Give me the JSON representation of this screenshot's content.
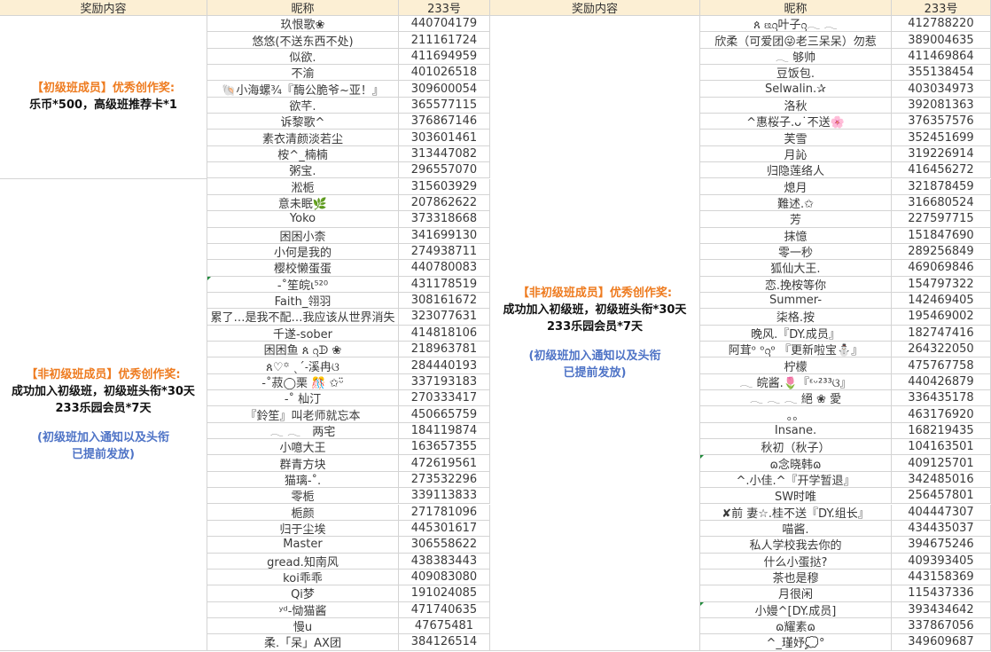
{
  "headers": {
    "reward": "奖励内容",
    "nickname": "昵称",
    "id": "233号"
  },
  "left": {
    "reward_blocks": [
      {
        "title": "【初级班成员】优秀创作奖:",
        "lines": [
          "乐币*500，高级班推荐卡*1"
        ],
        "note_lines": []
      },
      {
        "title": "【非初级班成员】优秀创作奖:",
        "lines": [
          "成功加入初级班，初级班头衔*30天",
          "233乐园会员*7天"
        ],
        "note_lines": [
          "(初级班加入通知以及头衔",
          "已提前发放)"
        ]
      }
    ],
    "rows": [
      {
        "name": "玖恨歌❀",
        "id": "440704179"
      },
      {
        "name": "悠悠(不送东西不处)",
        "id": "211161724"
      },
      {
        "name": "似欲.",
        "id": "411694959"
      },
      {
        "name": "不渝",
        "id": "401026518"
      },
      {
        "name": "🐚小海螺¾『酶公脆爷~亚！』",
        "id": "309600054"
      },
      {
        "name": "欲芊.",
        "id": "365577115"
      },
      {
        "name": "诉黎歌^",
        "id": "376867146"
      },
      {
        "name": "素衣清颜淡若尘",
        "id": "303601461"
      },
      {
        "name": "桉^_楠楠",
        "id": "313447082"
      },
      {
        "name": "粥宝.",
        "id": "296557070"
      },
      {
        "name": "淞栀",
        "id": "315603929"
      },
      {
        "name": "意未眠🌿",
        "id": "207862622"
      },
      {
        "name": "Yoko",
        "id": "373318668"
      },
      {
        "name": "困困小柰",
        "id": "341699130"
      },
      {
        "name": "小何是我的",
        "id": "274938711"
      },
      {
        "name": "樱校懒蛋蛋",
        "id": "440780083"
      },
      {
        "name": "-˚笙皖ι⁵²⁰",
        "id": "431178519"
      },
      {
        "name": "Faith_翎羽",
        "id": "308161672"
      },
      {
        "name": "累了…是我不配…我应该从世界消失",
        "id": "323077631"
      },
      {
        "name": "千遂-sober",
        "id": "414818106"
      },
      {
        "name": "困困鱼 ጰ ᦋᗬ ❀",
        "id": "218963781"
      },
      {
        "name": "ጰ♡꙳ ˎˊ˗溪冉ଓ",
        "id": "284440193"
      },
      {
        "name": "-˚菽◯栗 🎊 ✩ᵕ̈",
        "id": "337193183"
      },
      {
        "name": "-˚ 杣汀",
        "id": "270333417"
      },
      {
        "name": "『鈴笙』叫老师就忘本",
        "id": "450665759"
      },
      {
        "name": "𓂃 𓂃　两宅",
        "id": "184119874"
      },
      {
        "name": "小噫大王",
        "id": "163657355"
      },
      {
        "name": "群青方块",
        "id": "472619561"
      },
      {
        "name": "猫璃-˚.",
        "id": "273532296"
      },
      {
        "name": "零栀",
        "id": "339113833"
      },
      {
        "name": "栀颜",
        "id": "271781096"
      },
      {
        "name": "归于尘埃",
        "id": "445301617"
      },
      {
        "name": "Master",
        "id": "306558622"
      },
      {
        "name": "gread.知南风",
        "id": "438383443"
      },
      {
        "name": "koi乖乖",
        "id": "409083080"
      },
      {
        "name": "Qi梦",
        "id": "191024085"
      },
      {
        "name": "ʸᵈ-恸猫酱",
        "id": "471740635"
      },
      {
        "name": "慢u",
        "id": "47675481"
      },
      {
        "name": "柔.「呆」AX团",
        "id": "384126514"
      }
    ]
  },
  "right": {
    "reward_blocks": [
      {
        "title": "【非初级班成员】优秀创作奖:",
        "lines": [
          "成功加入初级班，初级班头衔*30天",
          "233乐园会员*7天"
        ],
        "note_lines": [
          "(初级班加入通知以及头衔",
          "已提前发放)"
        ]
      }
    ],
    "rows": [
      {
        "name": "ጰ ᦕᦋ叶子ᦋ𓂃 𓂃",
        "id": "412788220"
      },
      {
        "name": "欣柔（可爱团😜老三呆呆）勿惹",
        "id": "389004635"
      },
      {
        "name": "𓂃 够帅",
        "id": "411469864"
      },
      {
        "name": "豆饭包.",
        "id": "355138454"
      },
      {
        "name": "Selwalin.✰",
        "id": "403034973"
      },
      {
        "name": "洛秋",
        "id": "392081363"
      },
      {
        "name": "^惠桜子.ᴗ˙不送🌸",
        "id": "376357576"
      },
      {
        "name": "芙雪",
        "id": "352451699"
      },
      {
        "name": "月訫",
        "id": "319226914"
      },
      {
        "name": "归隐莲络人",
        "id": "416456272"
      },
      {
        "name": "熄月",
        "id": "321878459"
      },
      {
        "name": "難述.✩",
        "id": "316680524"
      },
      {
        "name": "芳",
        "id": "227597715"
      },
      {
        "name": "抹憶",
        "id": "151847690"
      },
      {
        "name": "零一秒",
        "id": "289256849"
      },
      {
        "name": "狐仙大王.",
        "id": "469069846"
      },
      {
        "name": "恋.挽桉等你",
        "id": "154797322"
      },
      {
        "name": "Summer-",
        "id": "142469405"
      },
      {
        "name": "柒格.按",
        "id": "195469002"
      },
      {
        "name": "晚风.『DY.成员』",
        "id": "182747416"
      },
      {
        "name": "阿茸ᵒ ᵒᦋᵒ 『更新啦宝⛄』",
        "id": "264322050"
      },
      {
        "name": "柠檬",
        "id": "475767758"
      },
      {
        "name": "𓂃 皖酱.🌷『ᵋᵕ²³³ଓ』",
        "id": "440426879"
      },
      {
        "name": "𓂃 𓂃 𓂃 絕 ❀ 愛",
        "id": "336435178"
      },
      {
        "name": "。。",
        "id": "463176920"
      },
      {
        "name": "Insane.",
        "id": "168219435"
      },
      {
        "name": "秋初（秋子）",
        "id": "104163501"
      },
      {
        "name": "ɷ念晓韩ɷ",
        "id": "409125701"
      },
      {
        "name": "^.小佳.^『开学暂退』",
        "id": "342485016"
      },
      {
        "name": "SW时唯",
        "id": "256457801"
      },
      {
        "name": "✘前 妻☆.桂不送『DY.组长』",
        "id": "404447307"
      },
      {
        "name": "喵酱.",
        "id": "434435037"
      },
      {
        "name": "私人学校我去你的",
        "id": "394675246"
      },
      {
        "name": "什么小蛋挞?",
        "id": "409393405"
      },
      {
        "name": "茶也是穆",
        "id": "443158369"
      },
      {
        "name": "月很闲",
        "id": "115437336"
      },
      {
        "name": "小嫚^[DY.成员]",
        "id": "393434642"
      },
      {
        "name": "ɷ耀素ɷ",
        "id": "337867056"
      },
      {
        "name": "^_瑾妤💭°",
        "id": "349609687"
      }
    ]
  }
}
